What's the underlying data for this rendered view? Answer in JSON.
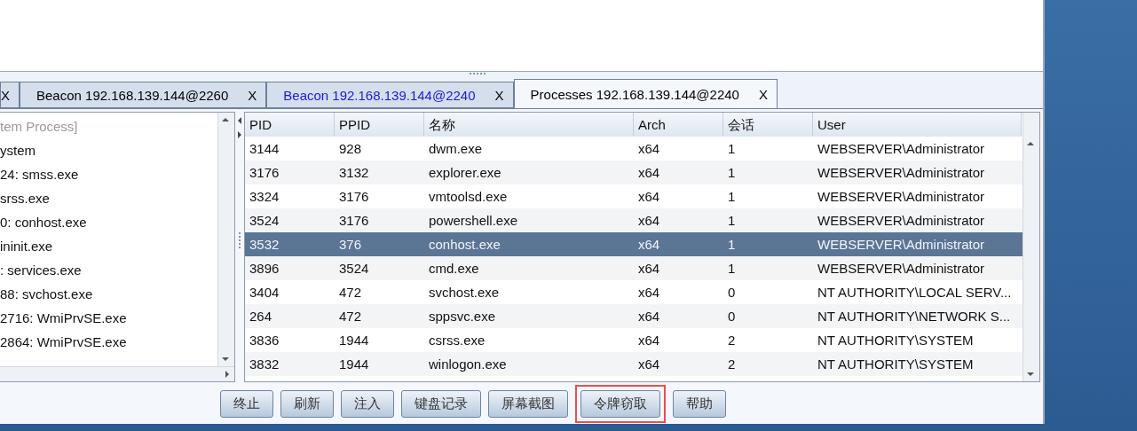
{
  "tabs": [
    {
      "close": "X",
      "selected": false,
      "color": "#000000"
    },
    {
      "label": "Beacon 192.168.139.144@2260",
      "close": "X",
      "selected": false,
      "color": "#000000"
    },
    {
      "label": "Beacon 192.168.139.144@2240",
      "close": "X",
      "selected": false,
      "color": "#1a1adc"
    },
    {
      "label": "Processes 192.168.139.144@2240",
      "close": "X",
      "selected": true,
      "color": "#000000"
    }
  ],
  "tree": {
    "items": [
      {
        "label": "tem Process]",
        "dim": true
      },
      {
        "label": "ystem",
        "dim": false
      },
      {
        "label": "24: smss.exe",
        "dim": false
      },
      {
        "label": "srss.exe",
        "dim": false
      },
      {
        "label": "0: conhost.exe",
        "dim": false
      },
      {
        "label": "ininit.exe",
        "dim": false
      },
      {
        "label": ": services.exe",
        "dim": false
      },
      {
        "label": "88: svchost.exe",
        "dim": false
      },
      {
        "label": "2716: WmiPrvSE.exe",
        "dim": false
      },
      {
        "label": "2864: WmiPrvSE.exe",
        "dim": false
      }
    ]
  },
  "table": {
    "columns": [
      "PID",
      "PPID",
      "名称",
      "Arch",
      "会话",
      "User"
    ],
    "rows": [
      {
        "cells": [
          "3144",
          "928",
          "dwm.exe",
          "x64",
          "1",
          "WEBSERVER\\Administrator"
        ],
        "selected": false
      },
      {
        "cells": [
          "3176",
          "3132",
          "explorer.exe",
          "x64",
          "1",
          "WEBSERVER\\Administrator"
        ],
        "selected": false
      },
      {
        "cells": [
          "3324",
          "3176",
          "vmtoolsd.exe",
          "x64",
          "1",
          "WEBSERVER\\Administrator"
        ],
        "selected": false
      },
      {
        "cells": [
          "3524",
          "3176",
          "powershell.exe",
          "x64",
          "1",
          "WEBSERVER\\Administrator"
        ],
        "selected": false
      },
      {
        "cells": [
          "3532",
          "376",
          "conhost.exe",
          "x64",
          "1",
          "WEBSERVER\\Administrator"
        ],
        "selected": true
      },
      {
        "cells": [
          "3896",
          "3524",
          "cmd.exe",
          "x64",
          "1",
          "WEBSERVER\\Administrator"
        ],
        "selected": false
      },
      {
        "cells": [
          "3404",
          "472",
          "svchost.exe",
          "x64",
          "0",
          "NT AUTHORITY\\LOCAL SERV..."
        ],
        "selected": false
      },
      {
        "cells": [
          "264",
          "472",
          "sppsvc.exe",
          "x64",
          "0",
          "NT AUTHORITY\\NETWORK S..."
        ],
        "selected": false
      },
      {
        "cells": [
          "3836",
          "1944",
          "csrss.exe",
          "x64",
          "2",
          "NT AUTHORITY\\SYSTEM"
        ],
        "selected": false
      },
      {
        "cells": [
          "3832",
          "1944",
          "winlogon.exe",
          "x64",
          "2",
          "NT AUTHORITY\\SYSTEM"
        ],
        "selected": false
      }
    ]
  },
  "buttons": [
    {
      "label": "终止",
      "highlighted": false
    },
    {
      "label": "刷新",
      "highlighted": false
    },
    {
      "label": "注入",
      "highlighted": false
    },
    {
      "label": "键盘记录",
      "highlighted": false
    },
    {
      "label": "屏幕截图",
      "highlighted": false
    },
    {
      "label": "令牌窃取",
      "highlighted": true
    },
    {
      "label": "帮助",
      "highlighted": false
    }
  ]
}
